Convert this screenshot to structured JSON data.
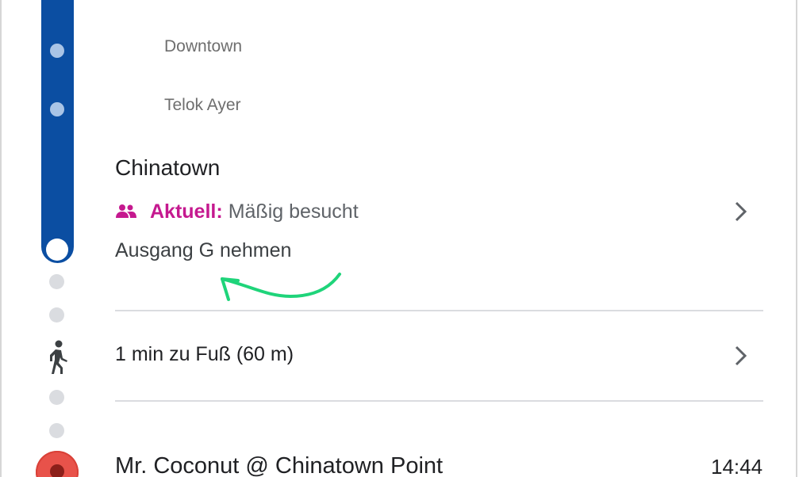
{
  "colors": {
    "route_line": "#0b4ea2",
    "crowd_accent": "#c5198f",
    "annotation": "#1fd47a",
    "destination_marker": "#e8524a"
  },
  "route": {
    "intermediate_stops": [
      "Downtown",
      "Telok Ayer"
    ],
    "station": {
      "name": "Chinatown",
      "crowd_icon": "people-icon",
      "crowd_label": "Aktuell:",
      "crowd_status": "Mäßig besucht",
      "exit_instruction": "Ausgang G nehmen"
    },
    "walk": {
      "icon": "walking-person-icon",
      "text": "1 min zu Fuß (60 m)"
    },
    "destination": {
      "name": "Mr. Coconut @ Chinatown Point",
      "time": "14:44"
    }
  }
}
